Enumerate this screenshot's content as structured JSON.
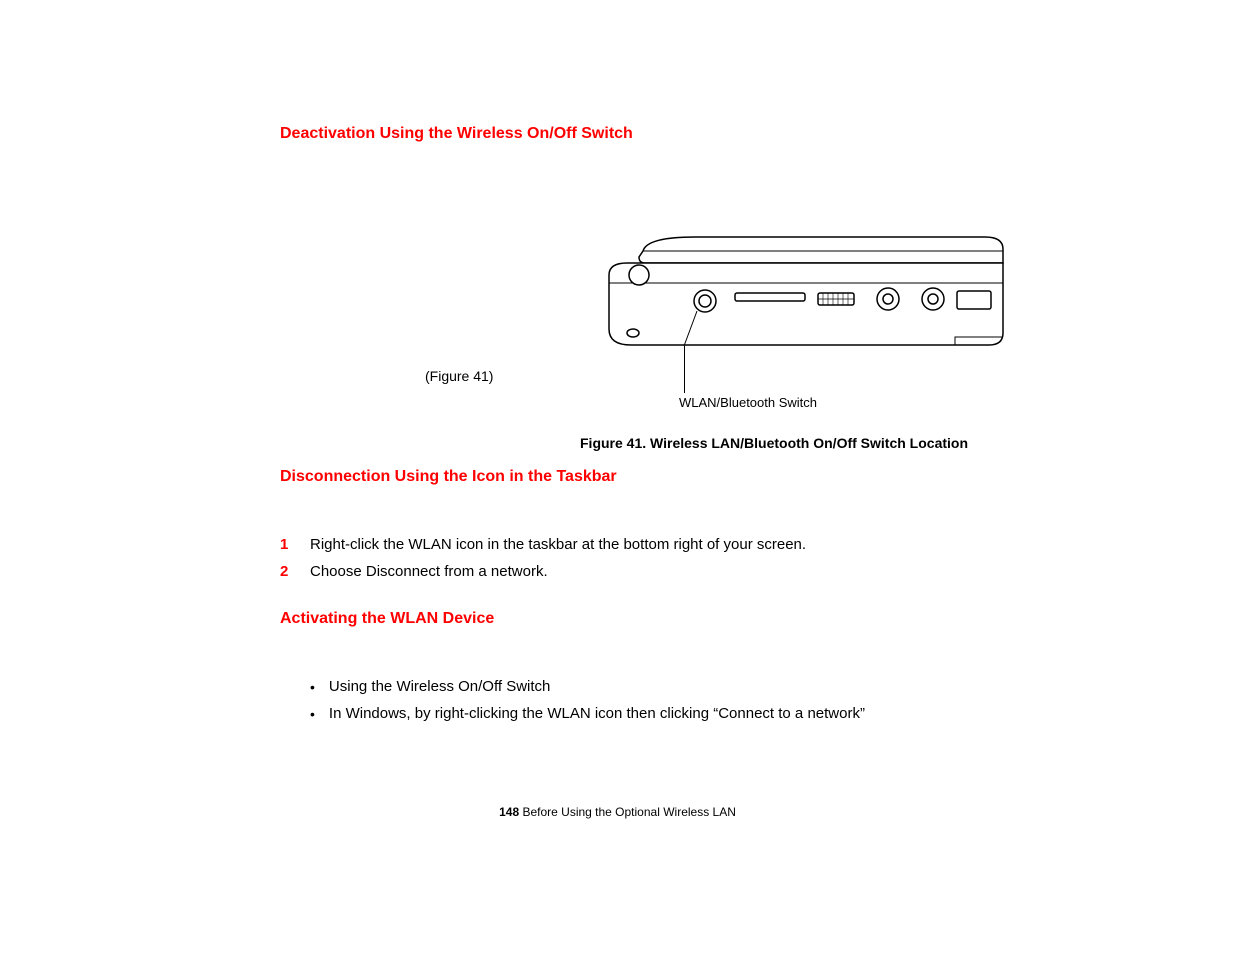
{
  "headings": {
    "h1": "Deactivation Using the Wireless On/Off Switch",
    "h2": "Disconnection Using the Icon in the Taskbar",
    "h3": "Activating the WLAN Device"
  },
  "figure": {
    "ref": "(Figure 41)",
    "callout": "WLAN/Bluetooth Switch",
    "caption": "Figure 41.  Wireless LAN/Bluetooth On/Off Switch Location"
  },
  "steps": {
    "n1": "1",
    "s1": "Right-click the WLAN icon in the taskbar at the bottom right of your screen.",
    "n2": "2",
    "s2": "Choose Disconnect from a network."
  },
  "bullets": {
    "b1": "Using the Wireless On/Off Switch",
    "b2": "In Windows, by right-clicking the WLAN icon then clicking “Connect to a network”"
  },
  "footer": {
    "page": "148",
    "text": " Before Using the Optional Wireless LAN"
  }
}
